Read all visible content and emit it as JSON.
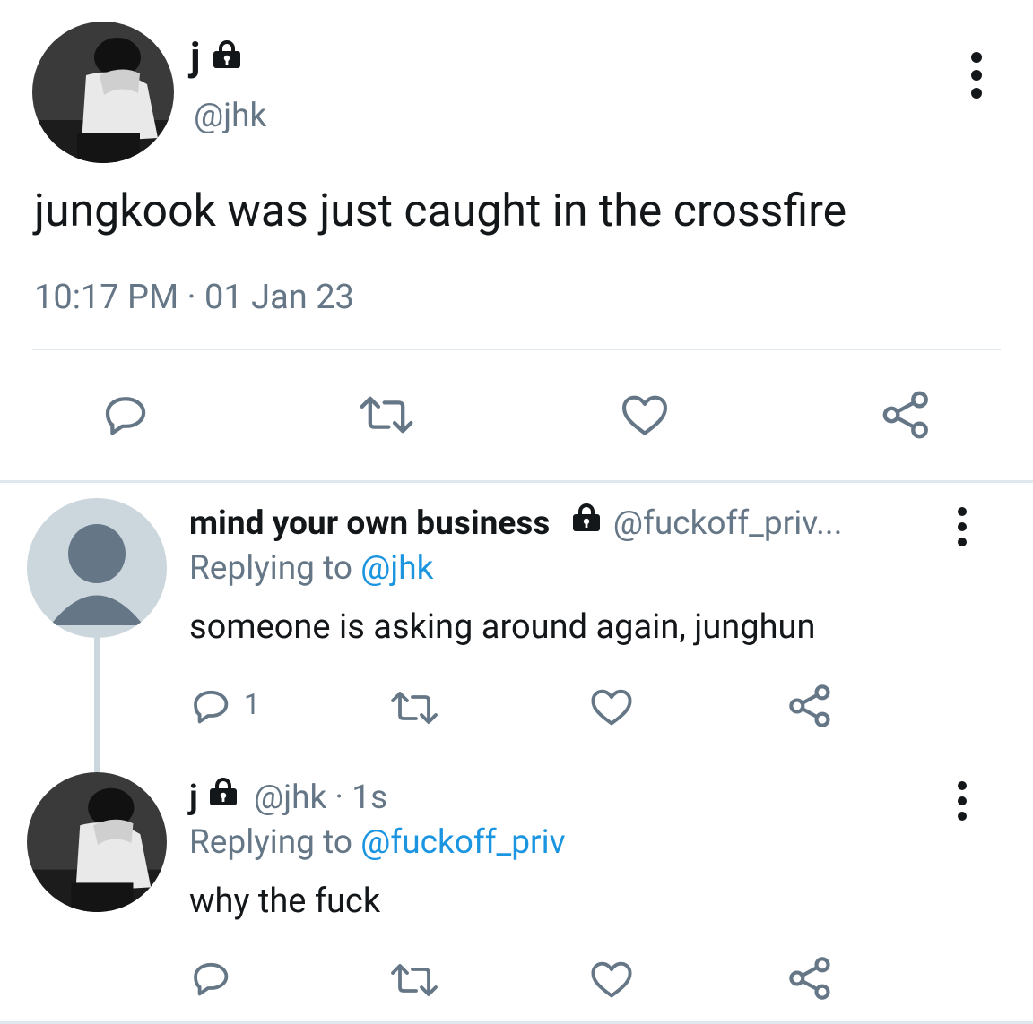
{
  "main_tweet": {
    "name": "j",
    "handle": "@jhk",
    "text": "jungkook was just caught in the crossfire",
    "time": "10:17 PM",
    "separator": "·",
    "date": "01 Jan 23"
  },
  "reply1": {
    "name": "mind your own business",
    "handle": "@fuckoff_priv...",
    "replying_prefix": "Replying to",
    "replying_to": "@jhk",
    "text": "someone is asking around again, junghun",
    "reply_count": "1"
  },
  "reply2": {
    "name": "j",
    "handle": "@jhk",
    "separator": "·",
    "time": "1s",
    "replying_prefix": "Replying to",
    "replying_to": "@fuckoff_priv",
    "text": "why the fuck"
  },
  "icons": [
    "lock-icon",
    "more-icon",
    "reply-icon",
    "retweet-icon",
    "like-icon",
    "share-icon",
    "default-avatar-icon"
  ],
  "colors": {
    "text": "#14171a",
    "secondary": "#657786",
    "link": "#1b95e0",
    "icon": "#657786",
    "divider": "#e1e8ed",
    "thread_line": "#ccd6dd"
  }
}
